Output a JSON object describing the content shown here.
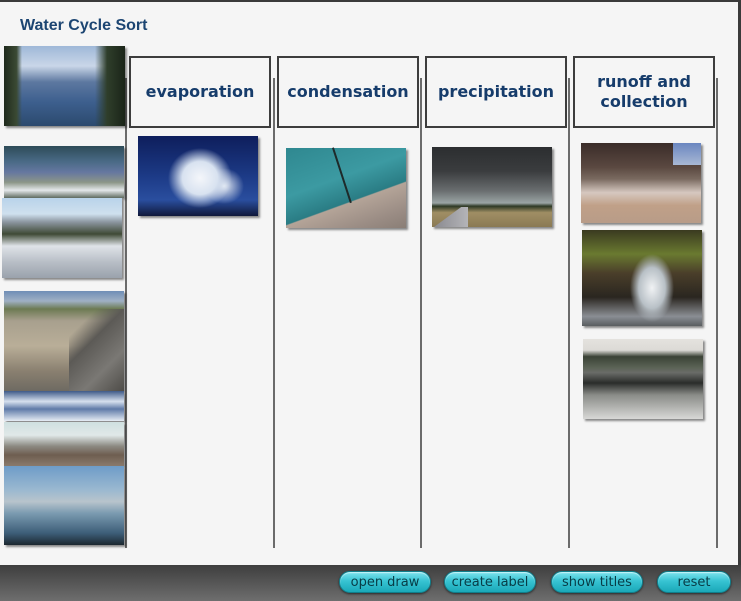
{
  "app": {
    "title": "Water Cycle Sort"
  },
  "columns": [
    {
      "label": "evaporation"
    },
    {
      "label": "condensation"
    },
    {
      "label": "precipitation"
    },
    {
      "label": "runoff and collection"
    }
  ],
  "unsorted_photos": [
    {
      "subject": "lake-with-trees"
    },
    {
      "subject": "coast-treeline"
    },
    {
      "subject": "rocky-surf"
    },
    {
      "subject": "muddy-river-bank"
    },
    {
      "subject": "snow-shadows"
    },
    {
      "subject": "rocky-shore"
    },
    {
      "subject": "misty-lake"
    }
  ],
  "sorted_photos": {
    "evaporation": [
      {
        "subject": "cumulus-cloud"
      }
    ],
    "condensation": [
      {
        "subject": "wet-umbrella"
      }
    ],
    "precipitation": [
      {
        "subject": "rainstorm-road"
      }
    ],
    "runoff_and_collection": [
      {
        "subject": "canyon-river"
      },
      {
        "subject": "waterfall"
      },
      {
        "subject": "rain-on-pond"
      }
    ]
  },
  "toolbar": {
    "open_draw": "open draw",
    "create_label": "create label",
    "show_titles": "show titles",
    "reset": "reset"
  },
  "colors": {
    "title": "#1c4572",
    "header_text": "#163c6b",
    "button": "#37c3d2",
    "bottom_bar": "#555555"
  }
}
